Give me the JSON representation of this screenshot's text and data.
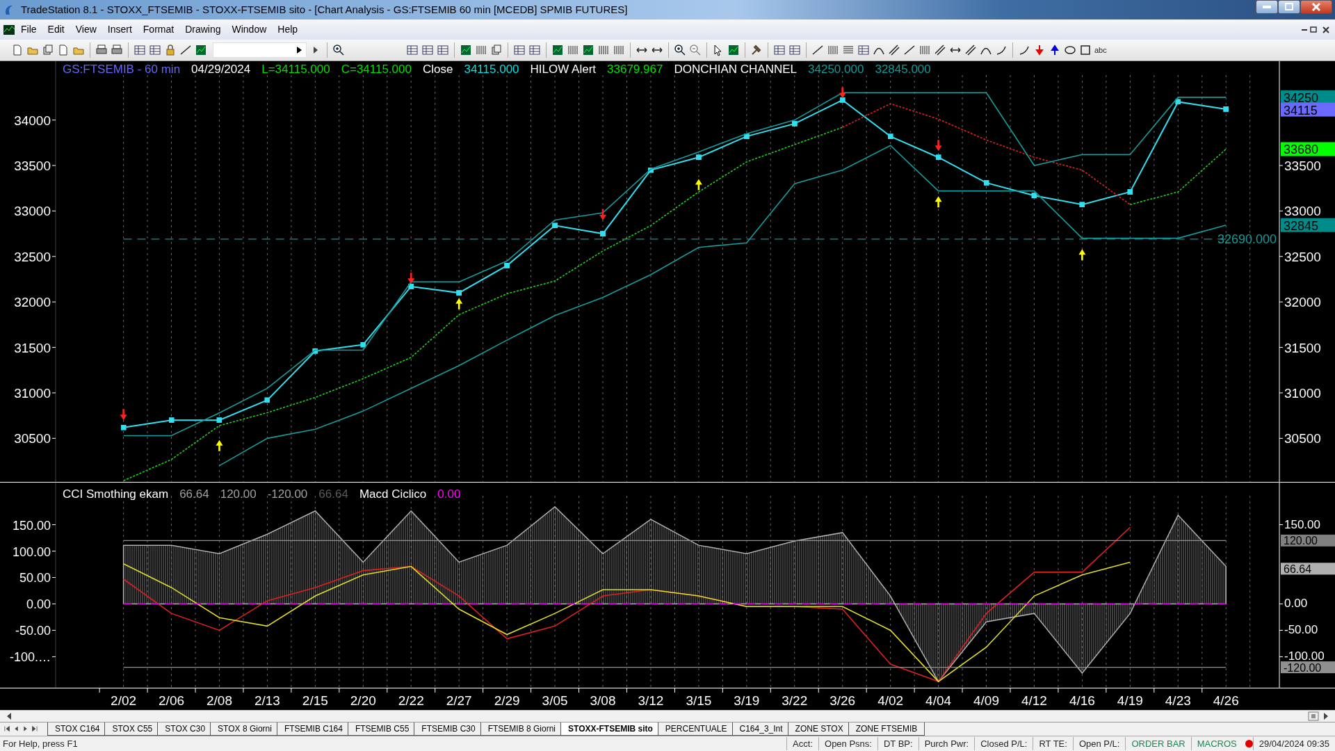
{
  "window": {
    "title": "TradeStation 8.1 - STOXX_FTSEMIB - STOXX-FTSEMIB sito - [Chart Analysis - GS:FTSEMIB  60 min  [MCEDB] SPMIB FUTURES]"
  },
  "menu": [
    "File",
    "Edit",
    "View",
    "Insert",
    "Format",
    "Drawing",
    "Window",
    "Help"
  ],
  "toolbar": {
    "text_tool": "abc"
  },
  "price_panel": {
    "header": [
      {
        "text": "GS:FTSEMIB - 60 min",
        "color": "#6666ff"
      },
      {
        "text": "04/29/2024",
        "color": "#ffffff"
      },
      {
        "text": "L=34115.000",
        "color": "#00e000"
      },
      {
        "text": "C=34115.000",
        "color": "#00e000"
      },
      {
        "text": "Close",
        "color": "#ffffff"
      },
      {
        "text": "34115.000",
        "color": "#00e0e0"
      },
      {
        "text": "HILOW Alert",
        "color": "#ffffff"
      },
      {
        "text": "33679.967",
        "color": "#00e000"
      },
      {
        "text": "DONCHIAN CHANNEL",
        "color": "#ffffff"
      },
      {
        "text": "34250.000",
        "color": "#109a9a"
      },
      {
        "text": "32845.000",
        "color": "#109a9a"
      }
    ],
    "right_ticks": [
      "33500",
      "33000",
      "32500",
      "32000",
      "31500",
      "31000",
      "30500"
    ],
    "markers": [
      {
        "text": "34250",
        "color": "#008b8b"
      },
      {
        "text": "34115",
        "color": "#6a6aff"
      },
      {
        "text": "33680",
        "color": "#00ff00"
      },
      {
        "text": "32845",
        "color": "#008b8b"
      }
    ],
    "chart_data": {
      "type": "line",
      "grid": true,
      "ylim": [
        30021,
        34647
      ],
      "yticks": [
        30500,
        31000,
        31500,
        32000,
        32500,
        33000,
        33500,
        34000
      ],
      "series": [
        {
          "color": "#30e0f0",
          "values": [
            30620,
            30700,
            30700,
            30920,
            31460,
            31530,
            32170,
            32100,
            32400,
            32840,
            32750,
            33450,
            33590,
            33820,
            33960,
            34220,
            33820,
            33590,
            33310,
            33170,
            33070,
            33210,
            34200,
            34120
          ]
        },
        {
          "color": "#20d020",
          "line_style": "dashed",
          "values": [
            30034,
            30268,
            30640,
            30782,
            30950,
            31156,
            31390,
            31860,
            32090,
            32230,
            32560,
            32840,
            33210,
            33540,
            33730,
            33920,
            null,
            null,
            null,
            null,
            null,
            33070,
            33210,
            33680
          ]
        },
        {
          "color": "#e02020",
          "line_style": "dashed",
          "values": [
            null,
            null,
            null,
            null,
            null,
            null,
            null,
            null,
            null,
            null,
            null,
            null,
            null,
            null,
            null,
            33920,
            34180,
            34010,
            33780,
            33590,
            33450,
            33070,
            null,
            null
          ]
        },
        {
          "color": "#169c9c",
          "values": [
            30530,
            30530,
            30780,
            31050,
            31470,
            31470,
            32220,
            32220,
            32450,
            32900,
            32980,
            33460,
            33650,
            33850,
            34000,
            34300,
            34300,
            34300,
            34300,
            33500,
            33620,
            33620,
            34250,
            34250
          ]
        },
        {
          "color": "#169c9c",
          "values": [
            null,
            null,
            30200,
            30500,
            30600,
            30800,
            31050,
            31300,
            31580,
            31850,
            32050,
            32300,
            32600,
            32650,
            33300,
            33450,
            33720,
            33220,
            33220,
            33220,
            32700,
            32700,
            32700,
            32845
          ]
        },
        {
          "type": "scatter",
          "color": "#ff2222",
          "values": [
            30760,
            null,
            null,
            null,
            null,
            null,
            32260,
            null,
            null,
            null,
            32960,
            null,
            null,
            null,
            null,
            34300,
            null,
            33720,
            null,
            null,
            null,
            null,
            null,
            null
          ]
        },
        {
          "type": "scatter",
          "color": "#ffff00",
          "values": [
            null,
            null,
            30420,
            null,
            null,
            null,
            null,
            31980,
            null,
            null,
            null,
            null,
            33290,
            null,
            null,
            null,
            null,
            33100,
            null,
            null,
            32520,
            null,
            null,
            null
          ]
        },
        {
          "color": "#1a8f8f",
          "line_style": "dashed",
          "values": [
            32690,
            32690,
            32690,
            32690,
            32690,
            32690,
            32690,
            32690,
            32690,
            32690,
            32690,
            32690,
            32690,
            32690,
            32690,
            32690,
            32690,
            32690,
            32690,
            32690,
            32690,
            32690,
            32690,
            32690
          ]
        }
      ]
    },
    "level_label": {
      "text": "32690.000",
      "color": "#1a9a9a"
    }
  },
  "oscillator_panel": {
    "header": [
      {
        "text": "CCI Smothing ekam",
        "color": "#ffffff"
      },
      {
        "text": "66.64",
        "color": "#a0a0a0"
      },
      {
        "text": "120.00",
        "color": "#a0a0a0"
      },
      {
        "text": "-120.00",
        "color": "#a0a0a0"
      },
      {
        "text": "66.64",
        "color": "#5a5a5a"
      },
      {
        "text": "Macd Ciclico",
        "color": "#ffffff"
      },
      {
        "text": "0.00",
        "color": "#ff00ff"
      }
    ],
    "right_ticks": [
      "150.00",
      "0.00",
      "-50.00",
      "-100.00"
    ],
    "markers": [
      {
        "text": "120.00",
        "color": "#808080"
      },
      {
        "text": "66.64",
        "color": "#b0b0b0"
      },
      {
        "text": "-120.00",
        "color": "#909090"
      }
    ],
    "chart_data": {
      "type": "line",
      "grid": true,
      "ylim": [
        -160,
        231
      ],
      "yticks": [
        {
          "value": 150,
          "label": "150.00"
        },
        {
          "value": 100,
          "label": "100.00"
        },
        {
          "value": 50,
          "label": "50.00"
        },
        {
          "value": 0,
          "label": "0.00"
        },
        {
          "value": -50,
          "label": "-50.00"
        },
        {
          "value": -100,
          "label": "-100.…"
        }
      ],
      "categories": [
        "2/02",
        "2/06",
        "2/08",
        "2/13",
        "2/15",
        "2/20",
        "2/22",
        "2/27",
        "2/29",
        "3/05",
        "3/08",
        "3/12",
        "3/15",
        "3/19",
        "3/22",
        "3/26",
        "4/02",
        "4/04",
        "4/09",
        "4/12",
        "4/16",
        "4/19",
        "4/23",
        "4/26"
      ],
      "series": [
        {
          "type": "area",
          "color": "#b0b0b0",
          "values": [
            111,
            111,
            95,
            132,
            176,
            79,
            176,
            79,
            111,
            184,
            95,
            160,
            111,
            95,
            119,
            135,
            15,
            -147,
            -34,
            -18,
            -131,
            -18,
            168,
            71
          ]
        },
        {
          "color": "#e02020",
          "values": [
            47,
            -18,
            -50,
            6,
            31,
            63,
            71,
            15,
            -66,
            -42,
            15,
            27,
            15,
            -5,
            -5,
            -10,
            -114,
            -147,
            -18,
            60,
            60,
            145,
            null,
            null
          ]
        },
        {
          "color": "#e0e020",
          "values": [
            76,
            31,
            -26,
            -42,
            15,
            55,
            71,
            -10,
            -58,
            -18,
            27,
            27,
            15,
            -5,
            -5,
            -5,
            -50,
            -147,
            -82,
            15,
            55,
            79,
            null,
            null
          ]
        },
        {
          "color": "#909090",
          "values": [
            120,
            120,
            120,
            120,
            120,
            120,
            120,
            120,
            120,
            120,
            120,
            120,
            120,
            120,
            120,
            120,
            120,
            120,
            120,
            120,
            120,
            120,
            120,
            120
          ]
        },
        {
          "color": "#909090",
          "values": [
            -120,
            -120,
            -120,
            -120,
            -120,
            -120,
            -120,
            -120,
            -120,
            -120,
            -120,
            -120,
            -120,
            -120,
            -120,
            -120,
            -120,
            -120,
            -120,
            -120,
            -120,
            -120,
            -120,
            -120
          ]
        },
        {
          "color": "#d000d0",
          "line_style": "dashed",
          "values": [
            0,
            0,
            0,
            0,
            0,
            0,
            0,
            0,
            0,
            0,
            0,
            0,
            0,
            0,
            0,
            0,
            0,
            0,
            0,
            0,
            0,
            0,
            0,
            0
          ]
        }
      ]
    }
  },
  "sheet_tabs": [
    {
      "label": "STOX C164",
      "selected": false
    },
    {
      "label": "STOX C55",
      "selected": false
    },
    {
      "label": "STOX  C30",
      "selected": false
    },
    {
      "label": "STOX  8 Giorni",
      "selected": false
    },
    {
      "label": "FTSEMIB C164",
      "selected": false
    },
    {
      "label": "FTSEMIB C55",
      "selected": false
    },
    {
      "label": "FTSEMIB C30",
      "selected": false
    },
    {
      "label": "FTSEMIB  8 Giorni",
      "selected": false
    },
    {
      "label": "STOXX-FTSEMIB sito",
      "selected": true
    },
    {
      "label": "PERCENTUALE",
      "selected": false
    },
    {
      "label": "C164_3_Int",
      "selected": false
    },
    {
      "label": "ZONE STOX",
      "selected": false
    },
    {
      "label": "ZONE FTSEMIB",
      "selected": false
    }
  ],
  "status_bar": {
    "help": "For Help, press F1",
    "fields": [
      "Acct:",
      "Open Psns:",
      "DT BP:",
      "Purch Pwr:",
      "Closed P/L:",
      "RT TE:",
      "Open P/L:"
    ],
    "order_bar": "ORDER BAR",
    "macros": "MACROS",
    "datetime": "29/04/2024 09:35"
  }
}
